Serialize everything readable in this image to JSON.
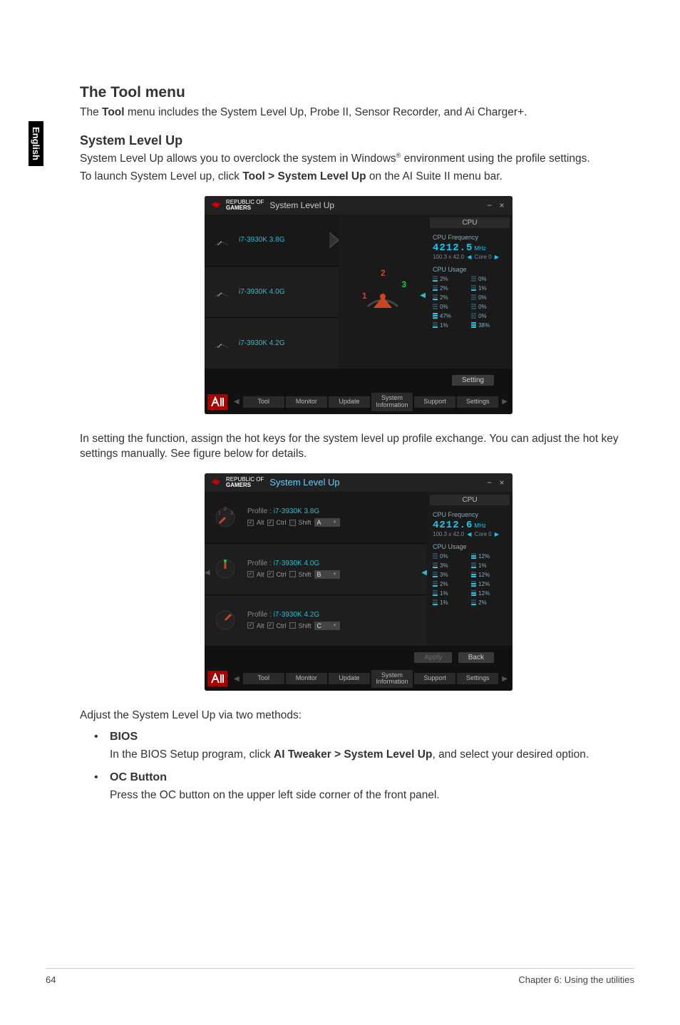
{
  "side_tab": "English",
  "h1": "The Tool menu",
  "p1_a": "The ",
  "p1_b": "Tool",
  "p1_c": " menu includes the System Level Up, Probe II, Sensor Recorder, and Ai Charger+.",
  "h2": "System Level Up",
  "p2_a": "System Level Up allows you to overclock the system in Windows",
  "p2_sup": "®",
  "p2_b": " environment using the profile settings.",
  "p3_a": "To launch System Level up, click ",
  "p3_b": "Tool > System Level Up",
  "p3_c": " on the AI Suite II menu bar.",
  "p4": "In setting the function, assign the hot keys for the system level up profile exchange.  You can adjust the hot key settings manually. See figure below for details.",
  "p5": "Adjust the System Level Up via two methods:",
  "li1_title": "BIOS",
  "li1_a": "In the BIOS Setup program, click ",
  "li1_b": "AI Tweaker > System Level Up",
  "li1_c": ", and select your desired option.",
  "li2_title": "OC Button",
  "li2_body": "Press the OC button on the upper left side corner of the front panel.",
  "footer_left": "64",
  "footer_right": "Chapter 6: Using the utilities",
  "shot": {
    "brand1": "REPUBLIC OF",
    "brand2": "GAMERS",
    "title": "System Level Up",
    "profiles": [
      "i7-3930K 3.8G",
      "i7-3930K 4.0G",
      "i7-3930K 4.2G"
    ],
    "dial_nums": [
      "1",
      "2",
      "3"
    ],
    "cpu_tab": "CPU",
    "freq_title": "CPU Frequency",
    "freq1": "4212.5",
    "freq_unit": "MHz",
    "freq_sub": "100.3 x 42.0",
    "core": "Core 0",
    "usage_title": "CPU Usage",
    "usage1": [
      [
        "2%",
        "0%"
      ],
      [
        "2%",
        "1%"
      ],
      [
        "2%",
        "0%"
      ],
      [
        "0%",
        "0%"
      ],
      [
        "47%",
        "0%"
      ],
      [
        "1%",
        "38%"
      ]
    ],
    "setting_btn": "Setting",
    "nav": [
      "Tool",
      "Monitor",
      "Update",
      "System Information",
      "Support",
      "Settings"
    ],
    "hk_profile_label": "Profile :",
    "hk_alt": "Alt",
    "hk_ctrl": "Ctrl",
    "hk_shift": "Shift",
    "hk_keys": [
      "A",
      "B",
      "C"
    ],
    "freq2": "4212.6",
    "usage2": [
      [
        "0%",
        "12%"
      ],
      [
        "3%",
        "1%"
      ],
      [
        "3%",
        "12%"
      ],
      [
        "2%",
        "12%"
      ],
      [
        "1%",
        "12%"
      ],
      [
        "1%",
        "2%"
      ]
    ],
    "apply_btn": "Apply",
    "back_btn": "Back"
  }
}
